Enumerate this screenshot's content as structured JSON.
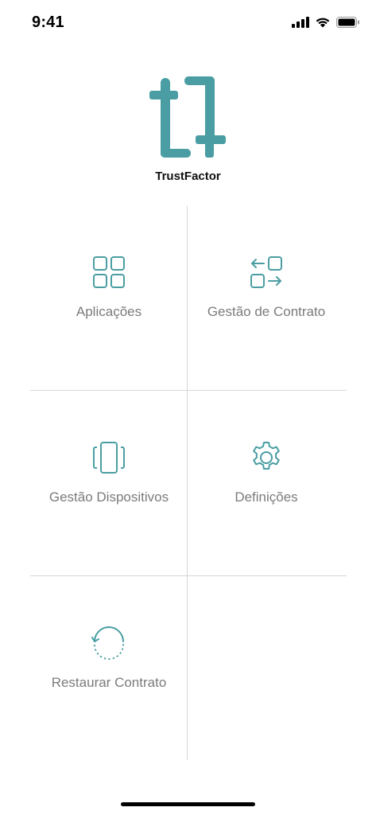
{
  "status_bar": {
    "time": "9:41",
    "icons": [
      "signal-icon",
      "wifi-icon",
      "battery-icon"
    ]
  },
  "brand": {
    "name": "TrustFactor",
    "logo_icon": "trustfactor-logo-icon",
    "accent_color": "#4a9ea3"
  },
  "menu": {
    "items": [
      {
        "label": "Aplicações",
        "icon": "apps-grid-icon"
      },
      {
        "label": "Gestão de Contrato",
        "icon": "contract-swap-icon"
      },
      {
        "label": "Gestão Dispositivos",
        "icon": "devices-icon"
      },
      {
        "label": "Definições",
        "icon": "gear-icon"
      },
      {
        "label": "Restaurar Contrato",
        "icon": "restore-icon"
      }
    ]
  },
  "colors": {
    "label": "#7b7b7b",
    "divider": "#d6d6d6",
    "icon": "#4a9ea3"
  }
}
